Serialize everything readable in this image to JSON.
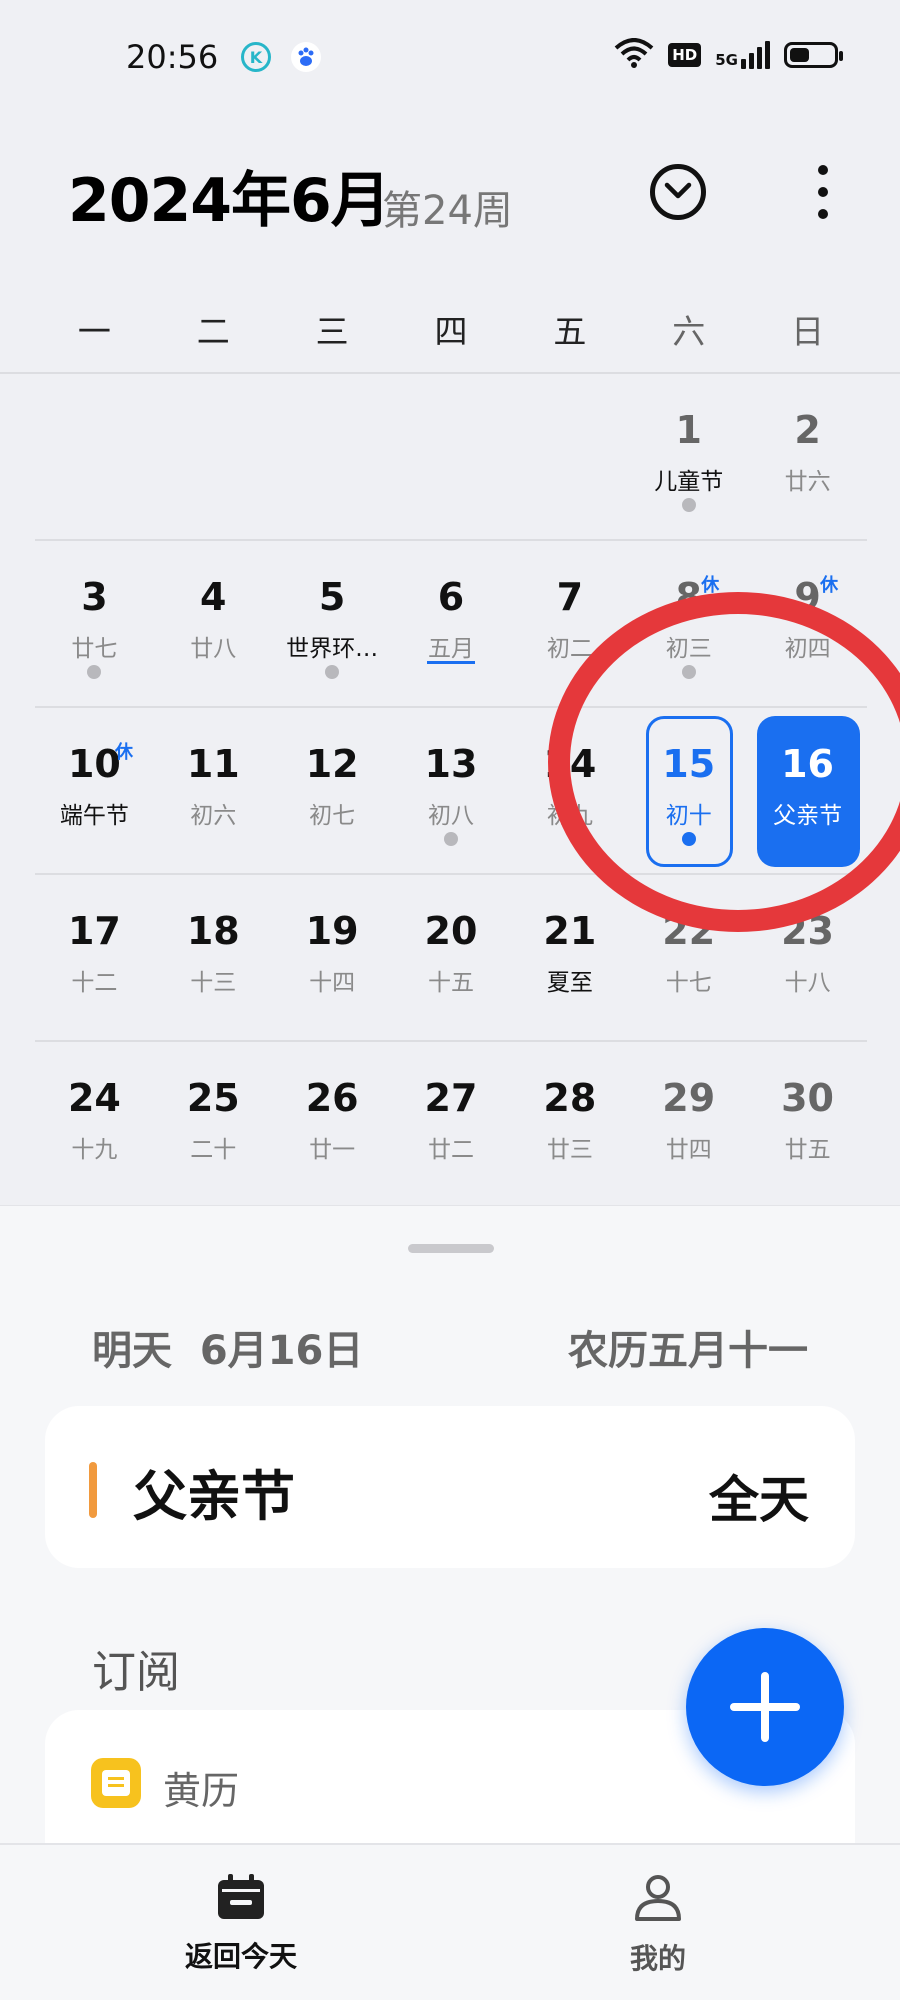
{
  "status_bar": {
    "time": "20:56",
    "app1": "K",
    "app2": "du",
    "network": "5G",
    "hd": "HD"
  },
  "header": {
    "title": "2024年6月",
    "week": "第24周"
  },
  "weekdays": [
    "一",
    "二",
    "三",
    "四",
    "五",
    "六",
    "日"
  ],
  "days": [
    {
      "num": "",
      "lunar": ""
    },
    {
      "num": "",
      "lunar": ""
    },
    {
      "num": "",
      "lunar": ""
    },
    {
      "num": "",
      "lunar": ""
    },
    {
      "num": "",
      "lunar": ""
    },
    {
      "num": "1",
      "lunar": "儿童节",
      "festival": true,
      "dot": true
    },
    {
      "num": "2",
      "lunar": "廿六"
    },
    {
      "num": "3",
      "lunar": "廿七",
      "dot": true
    },
    {
      "num": "4",
      "lunar": "廿八"
    },
    {
      "num": "5",
      "lunar": "世界环…",
      "festival": true,
      "dot": true
    },
    {
      "num": "6",
      "lunar": "五月",
      "underline": true
    },
    {
      "num": "7",
      "lunar": "初二"
    },
    {
      "num": "8",
      "lunar": "初三",
      "rest": "休",
      "dot": true
    },
    {
      "num": "9",
      "lunar": "初四",
      "rest": "休"
    },
    {
      "num": "10",
      "lunar": "端午节",
      "festival": true,
      "rest": "休"
    },
    {
      "num": "11",
      "lunar": "初六"
    },
    {
      "num": "12",
      "lunar": "初七"
    },
    {
      "num": "13",
      "lunar": "初八",
      "dot": true
    },
    {
      "num": "14",
      "lunar": "初九"
    },
    {
      "num": "15",
      "lunar": "初十",
      "today": true,
      "dot": true
    },
    {
      "num": "16",
      "lunar": "父亲节",
      "selected": true
    },
    {
      "num": "17",
      "lunar": "十二"
    },
    {
      "num": "18",
      "lunar": "十三"
    },
    {
      "num": "19",
      "lunar": "十四"
    },
    {
      "num": "20",
      "lunar": "十五"
    },
    {
      "num": "21",
      "lunar": "夏至",
      "festival": true
    },
    {
      "num": "22",
      "lunar": "十七"
    },
    {
      "num": "23",
      "lunar": "十八"
    },
    {
      "num": "24",
      "lunar": "十九"
    },
    {
      "num": "25",
      "lunar": "二十"
    },
    {
      "num": "26",
      "lunar": "廿一"
    },
    {
      "num": "27",
      "lunar": "廿二"
    },
    {
      "num": "28",
      "lunar": "廿三"
    },
    {
      "num": "29",
      "lunar": "廿四"
    },
    {
      "num": "30",
      "lunar": "廿五"
    }
  ],
  "detail": {
    "date_label": "明天  6月16日",
    "lunar_label": "农历五月十一",
    "event": {
      "name": "父亲节",
      "time": "全天",
      "color": "#f19a3e"
    },
    "subscriptions_title": "订阅",
    "subscription_item": "黄历"
  },
  "bottom_nav": {
    "today": "返回今天",
    "mine": "我的"
  },
  "colors": {
    "accent": "#1a6ff0",
    "fab": "#0b67f5",
    "annotation": "#e5383b"
  }
}
